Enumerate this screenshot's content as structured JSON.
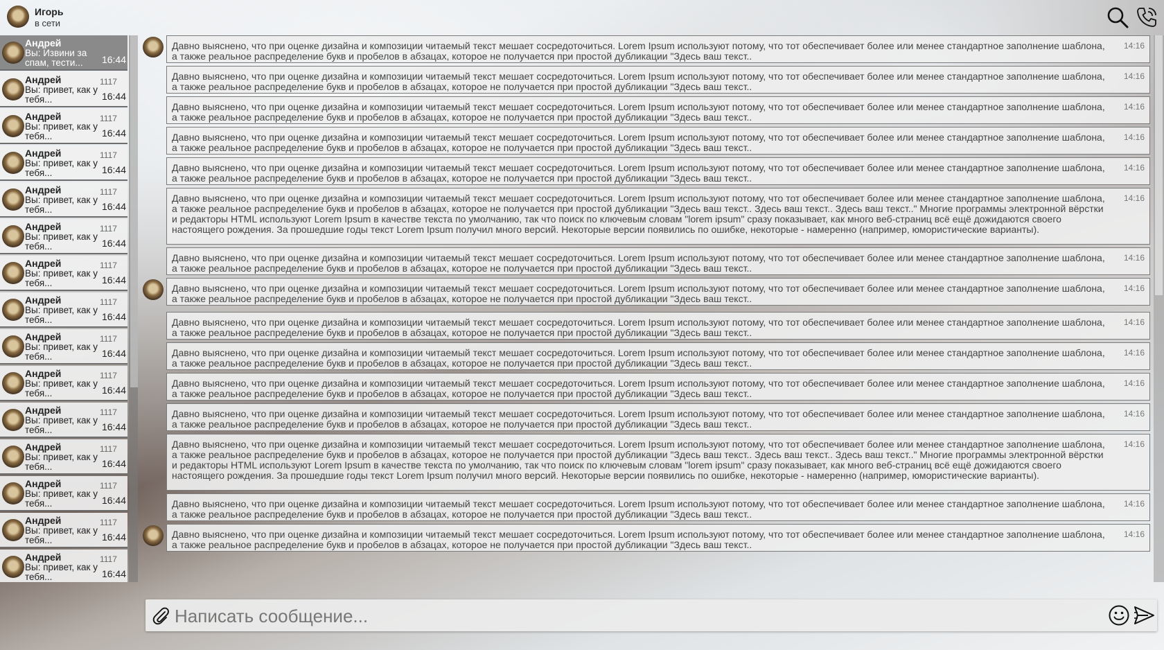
{
  "header": {
    "user_name": "Игорь",
    "user_status": "в сети",
    "search_icon": "search-icon",
    "call_icon": "phone-call-icon"
  },
  "chats": [
    {
      "name": "Андрей",
      "preview": "Вы: Извини за спам, тести...",
      "count": "",
      "time": "16:44",
      "active": true
    },
    {
      "name": "Андрей",
      "preview": "Вы: привет, как у тебя...",
      "count": "1117",
      "time": "16:44"
    },
    {
      "name": "Андрей",
      "preview": "Вы: привет, как у тебя...",
      "count": "1117",
      "time": "16:44"
    },
    {
      "name": "Андрей",
      "preview": "Вы: привет, как у тебя...",
      "count": "1117",
      "time": "16:44"
    },
    {
      "name": "Андрей",
      "preview": "Вы: привет, как у тебя...",
      "count": "1117",
      "time": "16:44"
    },
    {
      "name": "Андрей",
      "preview": "Вы: привет, как у тебя...",
      "count": "1117",
      "time": "16:44"
    },
    {
      "name": "Андрей",
      "preview": "Вы: привет, как у тебя...",
      "count": "1117",
      "time": "16:44"
    },
    {
      "name": "Андрей",
      "preview": "Вы: привет, как у тебя...",
      "count": "1117",
      "time": "16:44"
    },
    {
      "name": "Андрей",
      "preview": "Вы: привет, как у тебя...",
      "count": "1117",
      "time": "16:44"
    },
    {
      "name": "Андрей",
      "preview": "Вы: привет, как у тебя...",
      "count": "1117",
      "time": "16:44"
    },
    {
      "name": "Андрей",
      "preview": "Вы: привет, как у тебя...",
      "count": "1117",
      "time": "16:44"
    },
    {
      "name": "Андрей",
      "preview": "Вы: привет, как у тебя...",
      "count": "1117",
      "time": "16:44"
    },
    {
      "name": "Андрей",
      "preview": "Вы: привет, как у тебя...",
      "count": "1117",
      "time": "16:44"
    },
    {
      "name": "Андрей",
      "preview": "Вы: привет, как у тебя...",
      "count": "1117",
      "time": "16:44"
    },
    {
      "name": "Андрей",
      "preview": "Вы: привет, как у тебя...",
      "count": "1117",
      "time": "16:44"
    },
    {
      "name": "Андрей",
      "preview": "Вы: привет, как у тебя...",
      "count": "1117",
      "time": "16:44"
    }
  ],
  "message_texts": {
    "short": "Давно выяснено, что при оценке дизайна и композиции читаемый текст мешает сосредоточиться. Lorem Ipsum используют потому, что тот обеспечивает более или менее стандартное заполнение шаблона, а также реальное распределение букв и пробелов в абзацах, которое не получается при простой дубликации \"Здесь ваш текст..",
    "long": "Давно выяснено, что при оценке дизайна и композиции читаемый текст мешает сосредоточиться. Lorem Ipsum используют потому, что тот обеспечивает более или менее стандартное заполнение шаблона, а также реальное распределение букв и пробелов в абзацах, которое не получается при простой дубликации \"Здесь ваш текст.. Здесь ваш текст.. Здесь ваш текст..\" Многие программы электронной вёрстки и редакторы HTML используют Lorem Ipsum в качестве текста по умолчанию, так что поиск по ключевым словам \"lorem ipsum\" сразу показывает, как много веб-страниц всё ещё дожидаются своего настоящего рождения. За прошедшие годы текст Lorem Ipsum получил много версий. Некоторые версии появились по ошибке, некоторые - намеренно (например, юмористические варианты)."
  },
  "messages": [
    {
      "kind": "short",
      "time": "14:16",
      "avatar": true
    },
    {
      "kind": "short",
      "time": "14:16"
    },
    {
      "kind": "short",
      "time": "14:16"
    },
    {
      "kind": "short",
      "time": "14:16"
    },
    {
      "kind": "short",
      "time": "14:16"
    },
    {
      "kind": "long",
      "time": "14:16"
    },
    {
      "kind": "short",
      "time": "14:16"
    },
    {
      "kind": "short",
      "time": "14:16",
      "avatar": true
    },
    {
      "kind": "short",
      "time": "14:16"
    },
    {
      "kind": "short",
      "time": "14:16"
    },
    {
      "kind": "short",
      "time": "14:16"
    },
    {
      "kind": "short",
      "time": "14:16"
    },
    {
      "kind": "long",
      "time": "14:16"
    },
    {
      "kind": "short",
      "time": "14:16"
    },
    {
      "kind": "short",
      "time": "14:16",
      "avatar": true
    }
  ],
  "composer": {
    "placeholder": "Написать сообщение...",
    "attach_icon": "paperclip-icon",
    "emoji_icon": "smile-icon",
    "send_icon": "send-icon"
  }
}
